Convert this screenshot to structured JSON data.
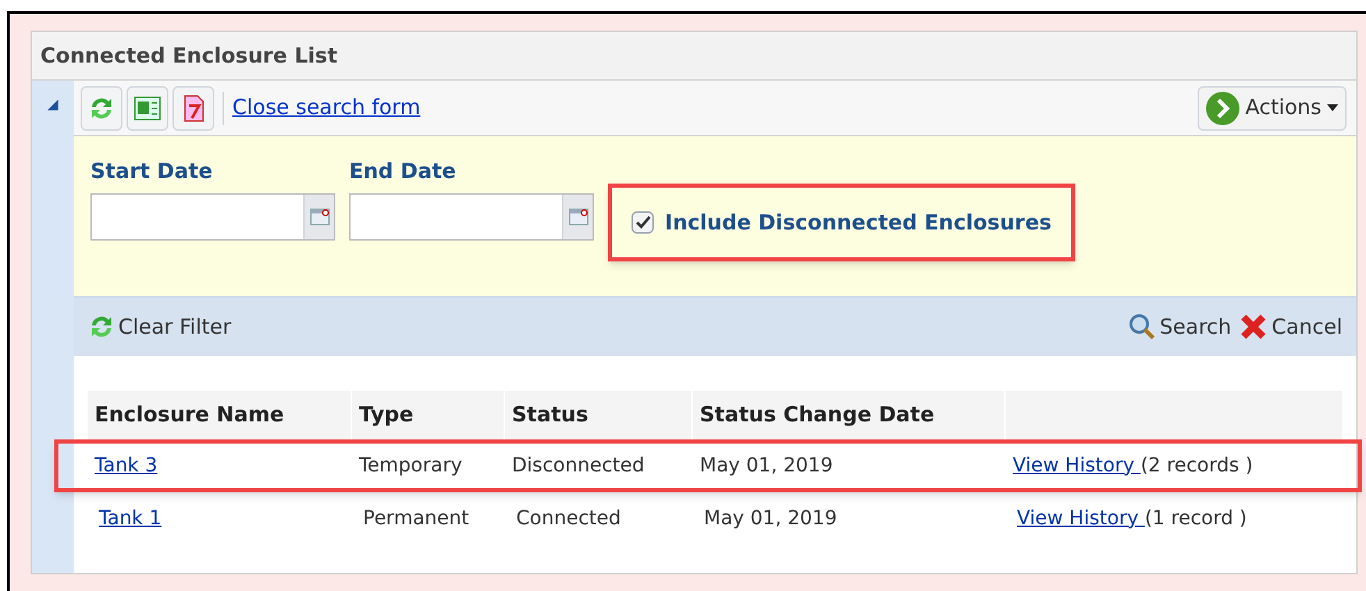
{
  "panel": {
    "title": "Connected Enclosure List",
    "collapse_glyph": "◢"
  },
  "toolbar": {
    "link": "Close search form",
    "actions": "Actions"
  },
  "filters": {
    "start_label": "Start Date",
    "end_label": "End Date",
    "checkbox": {
      "label": "Include Disconnected Enclosures",
      "checked": true,
      "highlighted": true
    }
  },
  "filter_bar": {
    "clear": "Clear Filter",
    "search": "Search",
    "cancel": "Cancel"
  },
  "table": {
    "columns": [
      "Enclosure Name",
      "Type",
      "Status",
      "Status Change Date"
    ],
    "rows": [
      {
        "name": "Tank 3",
        "type": "Temporary",
        "status": "Disconnected",
        "date": "May 01, 2019",
        "link": "View History ",
        "count": "(2 records )",
        "highlighted": true
      },
      {
        "name": "Tank 1",
        "type": "Permanent",
        "status": "Connected",
        "date": "May 01, 2019",
        "link": "View History ",
        "count": "(1 record )",
        "highlighted": false
      }
    ]
  }
}
